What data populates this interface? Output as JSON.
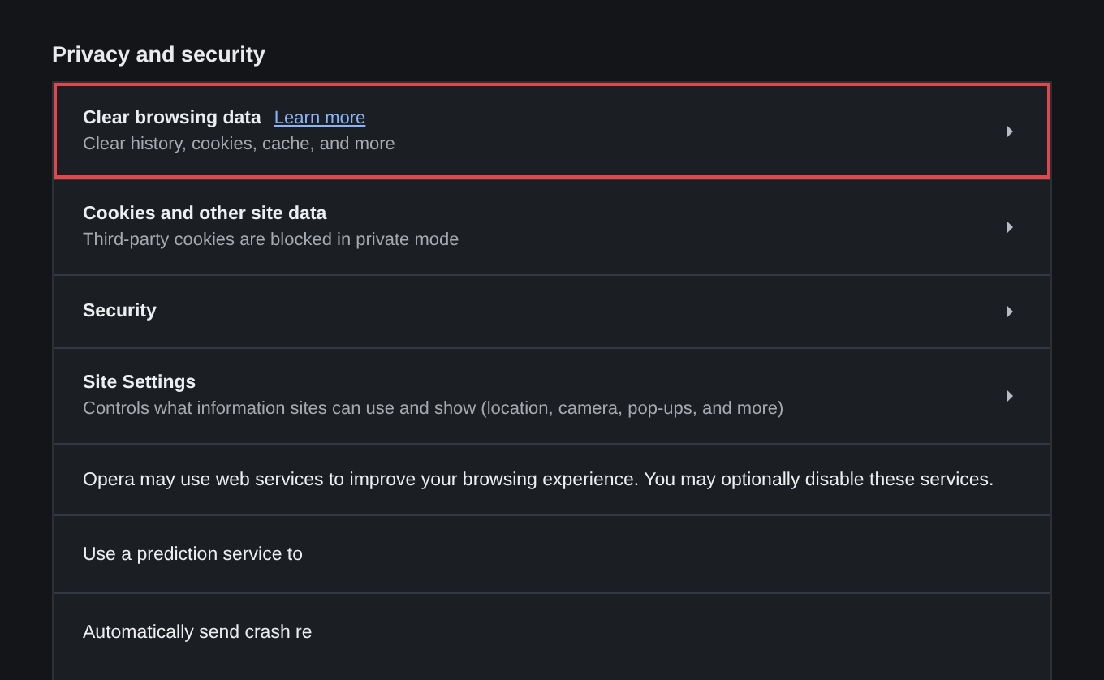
{
  "section": {
    "title": "Privacy and security"
  },
  "rows": [
    {
      "kind": "nav",
      "title": "Clear browsing data",
      "link": "Learn more",
      "subtitle": "Clear history, cookies, cache, and more",
      "highlighted": true
    },
    {
      "kind": "nav",
      "title": "Cookies and other site data",
      "subtitle": "Third-party cookies are blocked in private mode",
      "highlighted": false
    },
    {
      "kind": "nav",
      "title": "Security",
      "highlighted": false
    },
    {
      "kind": "nav",
      "title": "Site Settings",
      "subtitle": "Controls what information sites can use and show (location, camera, pop-ups, and more)",
      "highlighted": false
    },
    {
      "kind": "note",
      "title": "Opera may use web services to improve your browsing experience. You may optionally disable these services.",
      "highlighted": false
    },
    {
      "kind": "plain",
      "title": "Use a prediction service to",
      "highlighted": false
    },
    {
      "kind": "plain",
      "title": "Automatically send crash re",
      "highlighted": false
    }
  ]
}
